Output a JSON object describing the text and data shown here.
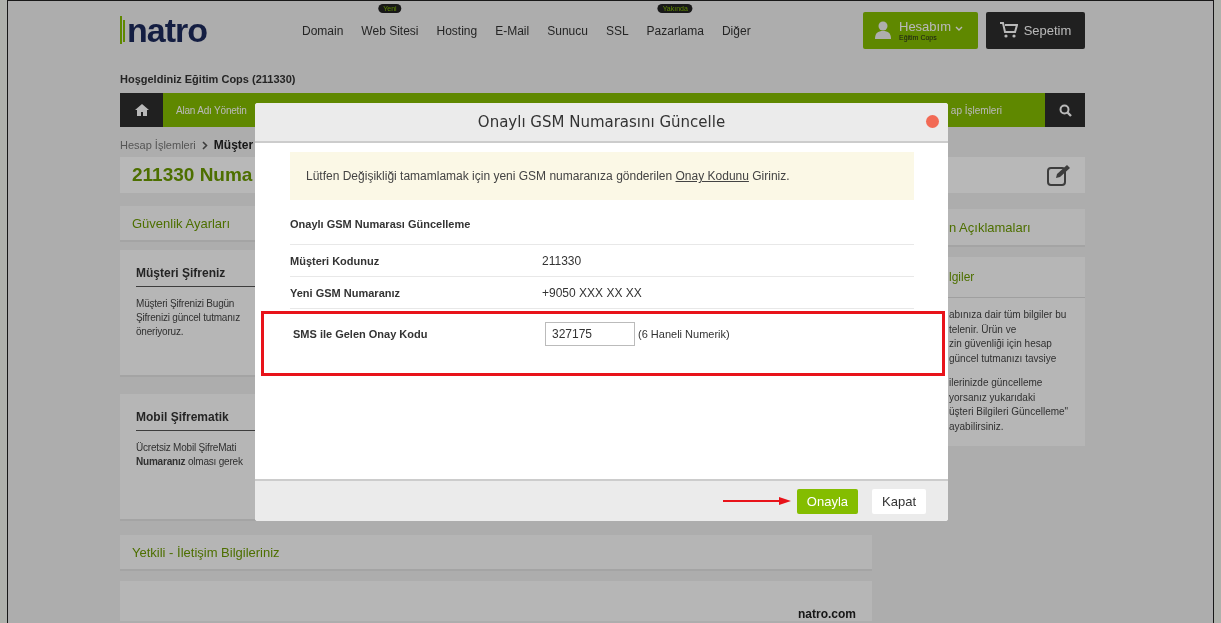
{
  "header": {
    "logo": "natro",
    "nav": [
      {
        "label": "Domain"
      },
      {
        "label": "Web Sitesi",
        "badge": "Yeni"
      },
      {
        "label": "Hosting"
      },
      {
        "label": "E-Mail"
      },
      {
        "label": "Sunucu"
      },
      {
        "label": "SSL"
      },
      {
        "label": "Pazarlama",
        "badge": "Yakında"
      },
      {
        "label": "Diğer"
      }
    ],
    "account": {
      "label": "Hesabım",
      "sub": "Eğitim Cops"
    },
    "cart": "Sepetim"
  },
  "welcome": "Hoşgeldiniz Eğitim Cops (211330)",
  "menu": {
    "first": "Alan Adı Yönetin",
    "last": "ap İşlemleri"
  },
  "breadcrumb": [
    "Hesap İşlemleri",
    "Müşter"
  ],
  "page_title": "211330 Numa",
  "security": {
    "heading": "Güvenlik Ayarları",
    "cards": [
      {
        "title": "Müşteri Şifreniz",
        "lines": [
          "Müşteri Şifrenizi Bugün",
          "Şifrenizi güncel tutmanız",
          "öneriyoruz."
        ]
      },
      {
        "title": "Mobil Şifrematik",
        "lines": [
          "Ücretsiz Mobil ŞifreMati",
          "**Numaranız** olması gerek"
        ]
      }
    ]
  },
  "contact": {
    "heading": "Yetkili - İletişim Bilgileriniz",
    "brand": "natro.com"
  },
  "sidebar": {
    "heading": "n Açıklamaları",
    "subheading": "lgiler",
    "paragraphs": [
      [
        "abınıza dair tüm bilgiler bu",
        "telenir. Ürün ve",
        "zin güvenliği için hesap",
        "güncel tutmanızı tavsiye"
      ],
      [
        "ilerinizde güncelleme",
        "yorsanız yukarıdaki",
        "üşteri Bilgileri Güncelleme\"",
        "ayabilirsiniz."
      ]
    ]
  },
  "dialog": {
    "title": "Onaylı GSM Numarasını Güncelle",
    "notice": {
      "before": "Lütfen Değişikliği tamamlamak için yeni GSM numaranıza gönderilen ",
      "link": "Onay Kodunu",
      "after": " Giriniz."
    },
    "rows": [
      {
        "kind": "heading",
        "label": "Onaylı GSM Numarası Güncelleme",
        "highlighted": false
      },
      {
        "kind": "text",
        "label": "Müşteri Kodunuz",
        "value": "211330",
        "highlighted": false
      },
      {
        "kind": "text",
        "label": "Yeni GSM Numaranız",
        "value": "+9050 XXX XX XX",
        "highlighted": false
      },
      {
        "kind": "input",
        "label": "SMS ile Gelen Onay Kodu",
        "value": "327175",
        "hint": "(6 Haneli Numerik)",
        "highlighted": true
      }
    ],
    "buttons": [
      {
        "label": "Onayla",
        "kind": "primary"
      },
      {
        "label": "Kapat",
        "kind": "secondary"
      }
    ]
  }
}
